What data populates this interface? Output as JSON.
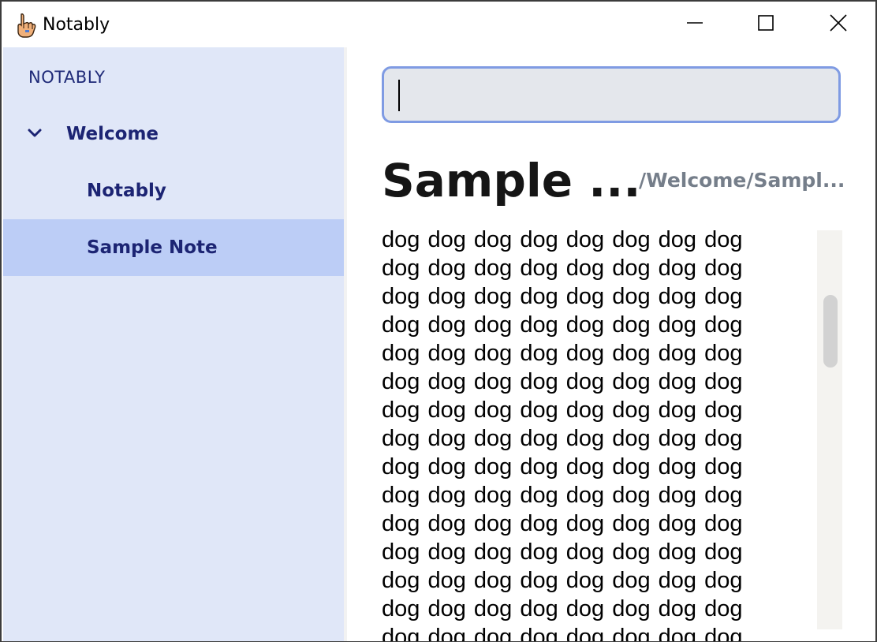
{
  "window": {
    "title": "Notably",
    "app_icon": "hand-pointing-icon",
    "controls": [
      "minimize-icon",
      "maximize-icon",
      "close-icon"
    ]
  },
  "sidebar": {
    "heading": "NOTABLY",
    "items": [
      {
        "label": "Welcome",
        "expanded": true,
        "icon": "chevron-down-icon"
      },
      {
        "label": "Notably"
      },
      {
        "label": "Sample Note",
        "selected": true
      }
    ]
  },
  "search": {
    "value": "",
    "placeholder": ""
  },
  "note": {
    "title": "Sample ...",
    "path": "/Welcome/Sampl...",
    "body_lines": [
      "dog dog dog dog dog dog dog dog",
      "dog dog dog dog dog dog dog dog",
      "dog dog dog dog dog dog dog dog",
      "dog dog dog dog dog dog dog dog",
      "dog dog dog dog dog dog dog dog",
      "dog dog dog dog dog dog dog dog",
      "dog dog dog dog dog dog dog dog",
      "dog dog dog dog dog dog dog dog",
      "dog dog dog dog dog dog dog dog",
      "dog dog dog dog dog dog dog dog",
      "dog dog dog dog dog dog dog dog",
      "dog dog dog dog dog dog dog dog",
      "dog dog dog dog dog dog dog dog",
      "dog dog dog dog dog dog dog dog",
      "dog dog dog dog dog dog dog dog"
    ]
  },
  "colors": {
    "sidebar_bg": "#e0e7f8",
    "selected_bg": "#bccdf6",
    "accent_text": "#1c2473",
    "search_border": "#7f9be3",
    "path_text": "#757e8a"
  }
}
